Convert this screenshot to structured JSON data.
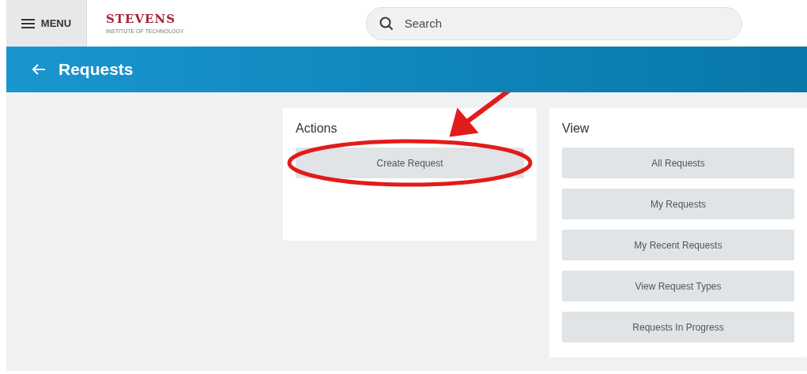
{
  "header": {
    "menu_label": "MENU",
    "logo": {
      "name": "STEVENS",
      "tagline": "INSTITUTE OF TECHNOLOGY"
    },
    "search": {
      "placeholder": "Search"
    }
  },
  "banner": {
    "title": "Requests"
  },
  "panels": [
    {
      "title": "Actions",
      "buttons": [
        {
          "label": "Create Request",
          "highlighted": true
        }
      ]
    },
    {
      "title": "View",
      "buttons": [
        {
          "label": "All Requests",
          "highlighted": false
        },
        {
          "label": "My Requests",
          "highlighted": false
        },
        {
          "label": "My Recent Requests",
          "highlighted": false
        },
        {
          "label": "View Request Types",
          "highlighted": false
        },
        {
          "label": "Requests In Progress",
          "highlighted": false
        }
      ]
    }
  ]
}
